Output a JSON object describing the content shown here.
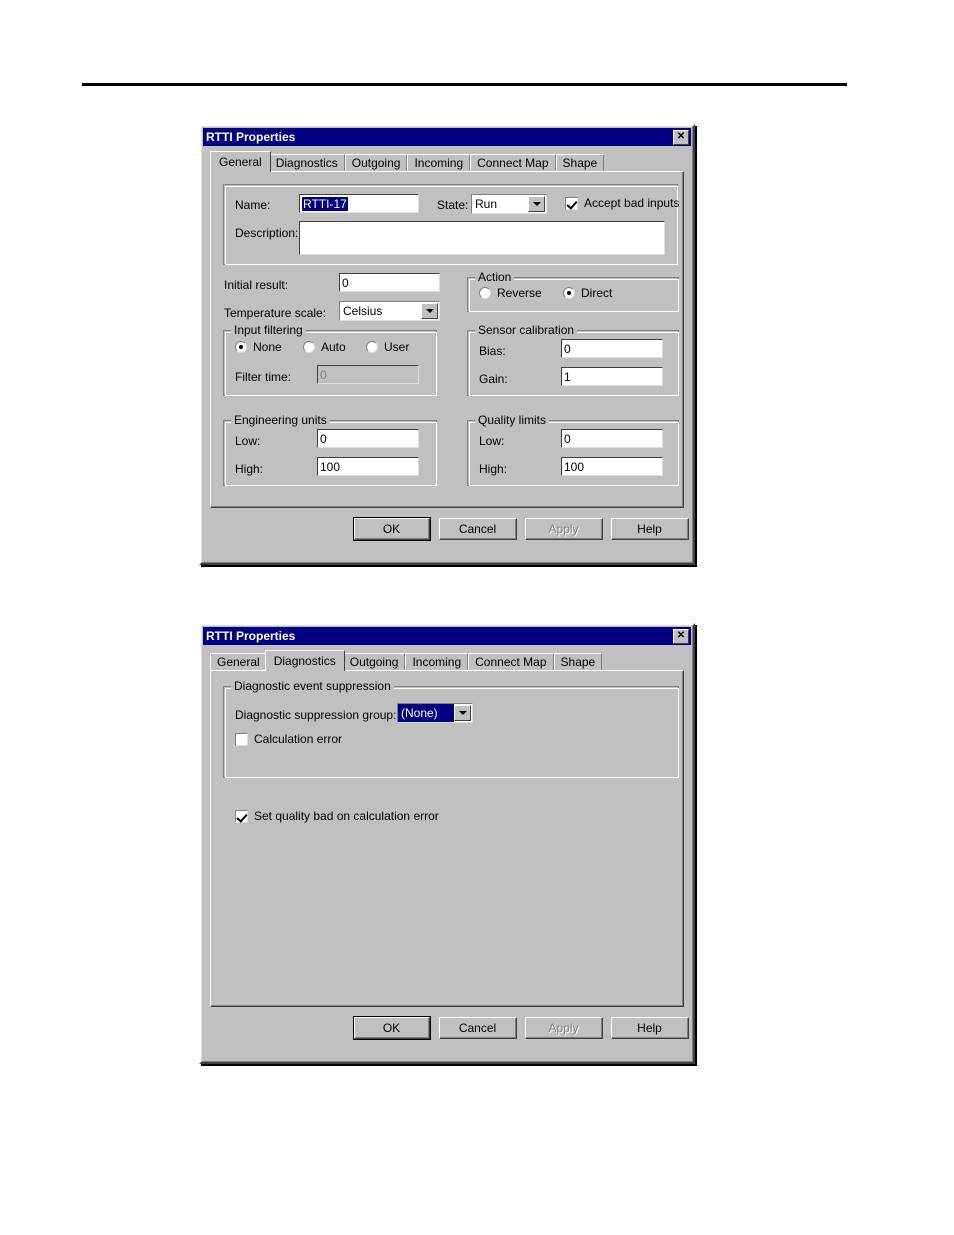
{
  "page": {
    "rule": "horizontal-rule"
  },
  "dialog_general": {
    "title": "RTTI Properties",
    "close_label": "✕",
    "tabs": [
      {
        "label": "General",
        "active": true
      },
      {
        "label": "Diagnostics",
        "active": false
      },
      {
        "label": "Outgoing",
        "active": false
      },
      {
        "label": "Incoming",
        "active": false
      },
      {
        "label": "Connect Map",
        "active": false
      },
      {
        "label": "Shape",
        "active": false
      }
    ],
    "identity": {
      "name_label": "Name:",
      "name_value": "RTTI-17",
      "state_label": "State:",
      "state_value": "Run",
      "state_options": [
        "Run"
      ],
      "accept_bad_inputs_label": "Accept bad inputs",
      "accept_bad_inputs_checked": true,
      "description_label": "Description:",
      "description_value": ""
    },
    "initial_result_label": "Initial result:",
    "initial_result_value": "0",
    "temperature_scale_label": "Temperature scale:",
    "temperature_scale_value": "Celsius",
    "temperature_scale_options": [
      "Celsius"
    ],
    "action": {
      "title": "Action",
      "reverse_label": "Reverse",
      "reverse_selected": false,
      "direct_label": "Direct",
      "direct_selected": true
    },
    "input_filtering": {
      "title": "Input filtering",
      "none_label": "None",
      "none_selected": true,
      "auto_label": "Auto",
      "auto_selected": false,
      "user_label": "User",
      "user_selected": false,
      "filter_time_label": "Filter time:",
      "filter_time_value": "0",
      "filter_time_enabled": false
    },
    "sensor_calibration": {
      "title": "Sensor calibration",
      "bias_label": "Bias:",
      "bias_value": "0",
      "gain_label": "Gain:",
      "gain_value": "1"
    },
    "engineering_units": {
      "title": "Engineering units",
      "low_label": "Low:",
      "low_value": "0",
      "high_label": "High:",
      "high_value": "100"
    },
    "quality_limits": {
      "title": "Quality limits",
      "low_label": "Low:",
      "low_value": "0",
      "high_label": "High:",
      "high_value": "100"
    },
    "buttons": {
      "ok": "OK",
      "cancel": "Cancel",
      "apply": "Apply",
      "help": "Help",
      "apply_enabled": false
    }
  },
  "dialog_diagnostics": {
    "title": "RTTI Properties",
    "close_label": "✕",
    "tabs": [
      {
        "label": "General",
        "active": false
      },
      {
        "label": "Diagnostics",
        "active": true
      },
      {
        "label": "Outgoing",
        "active": false
      },
      {
        "label": "Incoming",
        "active": false
      },
      {
        "label": "Connect Map",
        "active": false
      },
      {
        "label": "Shape",
        "active": false
      }
    ],
    "suppression": {
      "title": "Diagnostic event suppression",
      "group_label": "Diagnostic suppression group:",
      "group_value": "(None)",
      "group_options": [
        "(None)"
      ],
      "calculation_error_label": "Calculation error",
      "calculation_error_checked": false
    },
    "set_quality_bad_label": "Set quality bad on calculation error",
    "set_quality_bad_checked": true,
    "buttons": {
      "ok": "OK",
      "cancel": "Cancel",
      "apply": "Apply",
      "help": "Help",
      "apply_enabled": false
    }
  },
  "colors": {
    "dialog_face": "#c0c0c0",
    "titlebar": "#000080",
    "selection": "#000080",
    "field": "#ffffff",
    "disabled_text": "#808080"
  }
}
